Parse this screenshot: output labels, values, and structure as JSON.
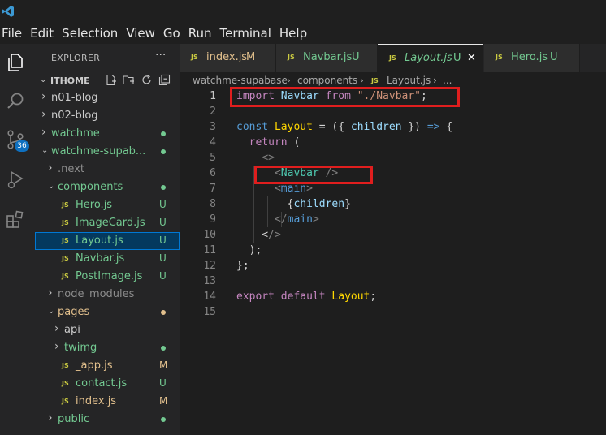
{
  "menu": [
    "File",
    "Edit",
    "Selection",
    "View",
    "Go",
    "Run",
    "Terminal",
    "Help"
  ],
  "activity": {
    "scm_badge": "36"
  },
  "sidebar": {
    "title": "EXPLORER",
    "more": "···",
    "section": "ITHOME",
    "items": [
      {
        "label": "n01-blog",
        "status": "",
        "color": "#cccccc"
      },
      {
        "label": "n02-blog",
        "status": "",
        "color": "#cccccc"
      },
      {
        "label": "watchme",
        "status": "dot",
        "color": "#73c991"
      },
      {
        "label": "watchme-supab...",
        "status": "dot",
        "color": "#73c991"
      },
      {
        "label": ".next",
        "status": "",
        "color": "#8c8c8c"
      },
      {
        "label": "components",
        "status": "dot",
        "color": "#73c991"
      },
      {
        "label": "Hero.js",
        "status": "U",
        "color": "#73c991"
      },
      {
        "label": "ImageCard.js",
        "status": "U",
        "color": "#73c991"
      },
      {
        "label": "Layout.js",
        "status": "U",
        "color": "#73c991"
      },
      {
        "label": "Navbar.js",
        "status": "U",
        "color": "#73c991"
      },
      {
        "label": "PostImage.js",
        "status": "U",
        "color": "#73c991"
      },
      {
        "label": "node_modules",
        "status": "",
        "color": "#8c8c8c"
      },
      {
        "label": "pages",
        "status": "dot",
        "color": "#e2c08d"
      },
      {
        "label": "api",
        "status": "",
        "color": "#cccccc"
      },
      {
        "label": "twimg",
        "status": "dot",
        "color": "#73c991"
      },
      {
        "label": "_app.js",
        "status": "M",
        "color": "#e2c08d"
      },
      {
        "label": "contact.js",
        "status": "U",
        "color": "#73c991"
      },
      {
        "label": "index.js",
        "status": "M",
        "color": "#e2c08d"
      },
      {
        "label": "public",
        "status": "dot",
        "color": "#73c991"
      }
    ]
  },
  "tabs": [
    {
      "label": "index.js",
      "status": "M",
      "color": "#e2c08d"
    },
    {
      "label": "Navbar.js",
      "status": "U",
      "color": "#73c991"
    },
    {
      "label": "Layout.js",
      "status": "U",
      "color": "#73c991"
    },
    {
      "label": "Hero.js",
      "status": "U",
      "color": "#73c991"
    }
  ],
  "breadcrumb": [
    "watchme-supabase",
    "components",
    "Layout.js",
    "..."
  ],
  "editor": {
    "line_numbers": [
      "1",
      "2",
      "3",
      "4",
      "5",
      "6",
      "7",
      "8",
      "9",
      "10",
      "11",
      "12",
      "13",
      "14",
      "15"
    ],
    "lines": [
      "import Navbar from \"./Navbar\";",
      "",
      "const Layout = ({ children }) => {",
      "  return (",
      "    <>",
      "      <Navbar />",
      "      <main>",
      "        {children}",
      "      </main>",
      "    </>",
      "  );",
      "};",
      "",
      "export default Layout;",
      ""
    ]
  },
  "colors": {
    "highlight_box": "#e01e1e",
    "accent": "#0078d4"
  }
}
